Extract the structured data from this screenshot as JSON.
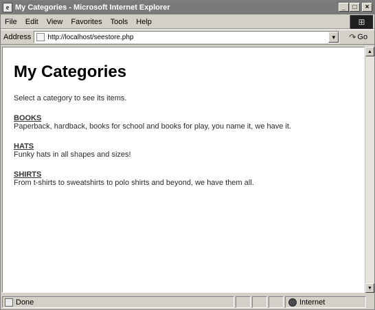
{
  "window": {
    "title": "My Categories - Microsoft Internet Explorer",
    "controls": {
      "minimize": "_",
      "maximize": "□",
      "close": "×"
    }
  },
  "menu": {
    "items": [
      {
        "label": "File"
      },
      {
        "label": "Edit"
      },
      {
        "label": "View"
      },
      {
        "label": "Favorites"
      },
      {
        "label": "Tools"
      },
      {
        "label": "Help"
      }
    ]
  },
  "address": {
    "label": "Address",
    "url": "http://localhost/seestore.php",
    "go_label": "Go"
  },
  "page": {
    "heading": "My Categories",
    "intro": "Select a category to see its items.",
    "categories": [
      {
        "name": "BOOKS",
        "description": "Paperback, hardback, books for school and books for play, you name it, we have it."
      },
      {
        "name": "HATS",
        "description": "Funky hats in all shapes and sizes!"
      },
      {
        "name": "SHIRTS",
        "description": "From t-shirts to sweatshirts to polo shirts and beyond, we have them all."
      }
    ]
  },
  "status": {
    "text": "Done",
    "zone": "Internet"
  },
  "icons": {
    "app": "ie-page-icon",
    "go": "go-arrow-icon",
    "zone": "internet-globe-icon"
  }
}
